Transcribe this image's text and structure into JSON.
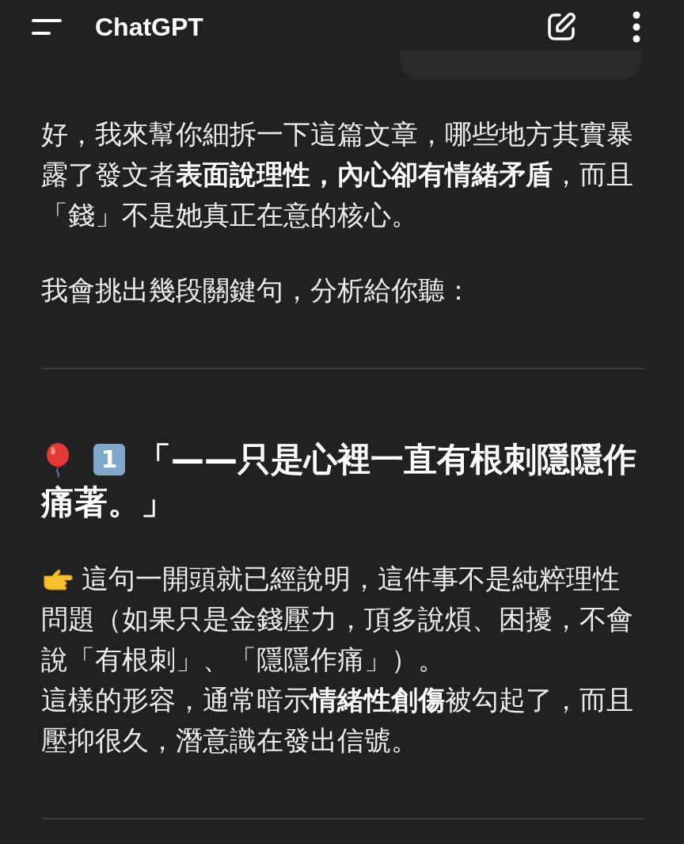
{
  "app_bar": {
    "title": "ChatGPT"
  },
  "blocks": [
    {
      "kind": "bubble"
    },
    {
      "kind": "paragraph",
      "text": "好，我來幫你細拆一下這篇文章，哪些地方其實暴露了發文者**表面說理性，內心卻有情緒矛盾**，而且「錢」不是她真正在意的核心。"
    },
    {
      "kind": "paragraph",
      "text": "我會挑出幾段關鍵句，分析給你聽："
    },
    {
      "kind": "divider"
    },
    {
      "kind": "heading",
      "number": "1",
      "lines": [
        "「——只是心裡一直有根刺隱隱作",
        "痛著。」"
      ]
    },
    {
      "kind": "pointer",
      "text": "這句一開頭就已經說明，這件事不是純粹理性問題（如果只是金錢壓力，頂多說煩、困擾，不會說「有根刺」、「隱隱作痛」）。"
    },
    {
      "kind": "line",
      "text": "這樣的形容，通常暗示**情緒性創傷**被勾起了，而且壓抑很久，潛意識在發出信號。"
    },
    {
      "kind": "divider"
    }
  ]
}
